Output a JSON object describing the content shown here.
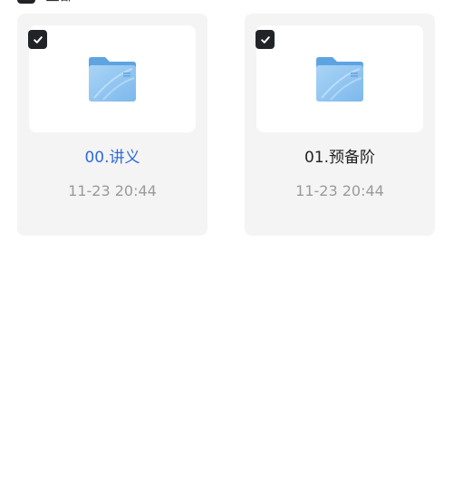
{
  "header": {
    "select_all_label": "全部"
  },
  "files": [
    {
      "name": "00.讲义",
      "date": "11-23 20:44",
      "checked": true,
      "icon": "folder-icon",
      "name_color": "#2f6bd8"
    },
    {
      "name": "01.预备阶",
      "date": "11-23 20:44",
      "checked": true,
      "icon": "folder-icon",
      "name_color": "#222222"
    }
  ],
  "colors": {
    "card_bg": "#f4f4f4",
    "checkbox_bg": "#222327",
    "folder_light": "#9fcdf3",
    "folder_dark": "#6aaee6"
  }
}
